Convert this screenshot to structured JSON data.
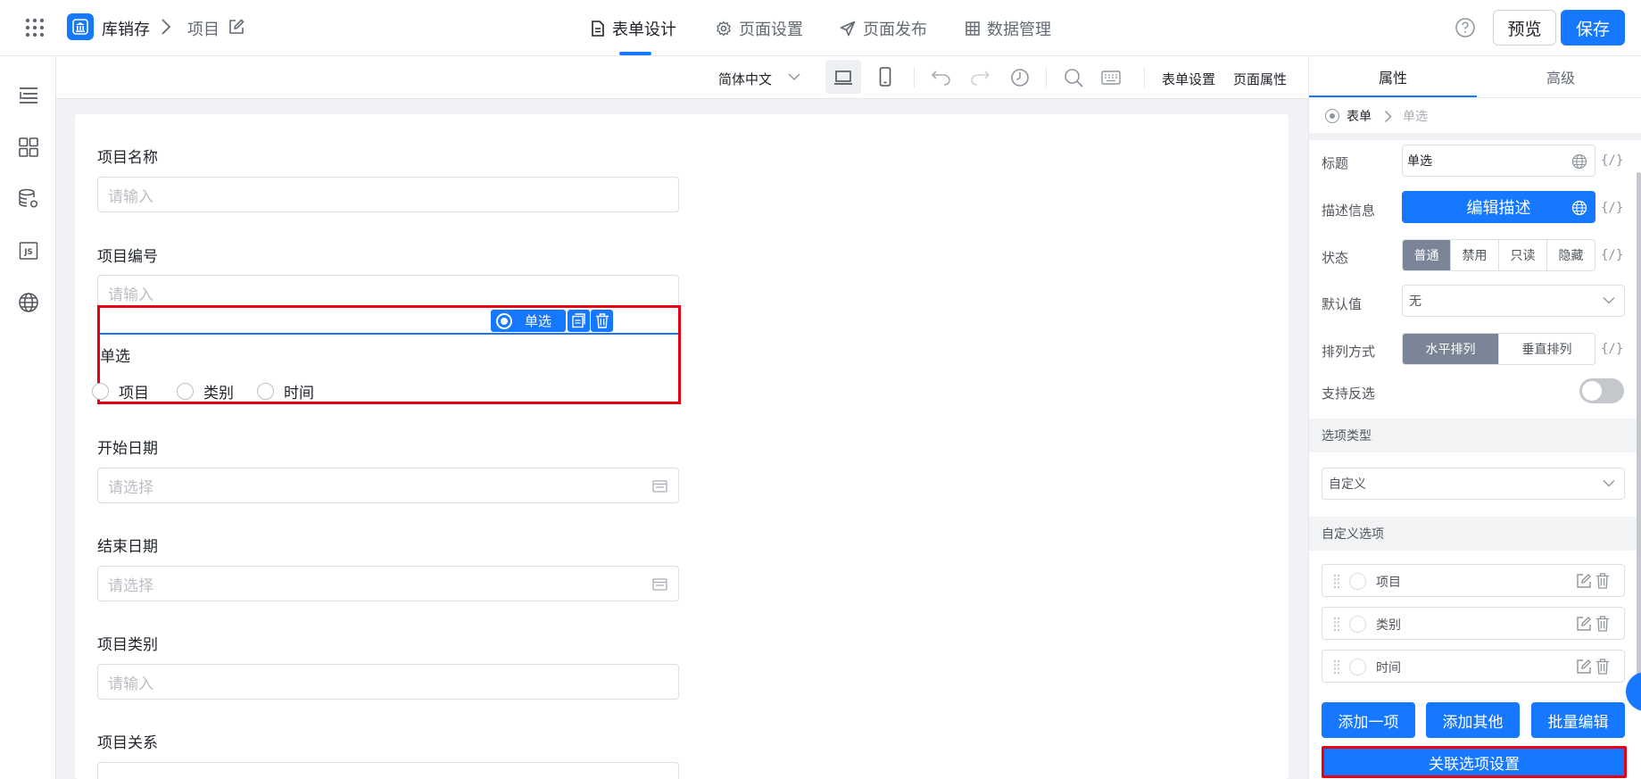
{
  "header": {
    "app_name": "库销存",
    "page_name": "项目",
    "tabs": [
      {
        "label": "表单设计",
        "icon": "document-icon"
      },
      {
        "label": "页面设置",
        "icon": "gear-icon"
      },
      {
        "label": "页面发布",
        "icon": "send-icon"
      },
      {
        "label": "数据管理",
        "icon": "grid-icon"
      }
    ],
    "preview_label": "预览",
    "save_label": "保存",
    "accent": "#1677ff"
  },
  "toolbar": {
    "language": "简体中文",
    "form_settings": "表单设置",
    "page_props": "页面属性"
  },
  "form": {
    "fields": [
      {
        "label": "项目名称",
        "placeholder": "请输入"
      },
      {
        "label": "项目编号",
        "placeholder": "请输入"
      },
      {
        "label": "开始日期",
        "placeholder": "请选择"
      },
      {
        "label": "结束日期",
        "placeholder": "请选择"
      },
      {
        "label": "项目类别",
        "placeholder": "请输入"
      },
      {
        "label": "项目关系",
        "placeholder": ""
      }
    ],
    "selected": {
      "chip_label": "单选",
      "title": "单选",
      "options": [
        "项目",
        "类别",
        "时间"
      ]
    }
  },
  "panel": {
    "tabs": [
      "属性",
      "高级"
    ],
    "crumb": [
      "表单",
      "单选"
    ],
    "title_label": "标题",
    "title_value": "单选",
    "desc_label": "描述信息",
    "desc_button": "编辑描述",
    "state_label": "状态",
    "states": [
      "普通",
      "禁用",
      "只读",
      "隐藏"
    ],
    "default_label": "默认值",
    "default_value": "无",
    "layout_label": "排列方式",
    "layouts": [
      "水平排列",
      "垂直排列"
    ],
    "deselect_label": "支持反选",
    "code_tag": "{/}",
    "option_type_heading": "选项类型",
    "option_type_value": "自定义",
    "custom_options_heading": "自定义选项",
    "options": [
      "项目",
      "类别",
      "时间"
    ],
    "add_one": "添加一项",
    "add_other": "添加其他",
    "batch_edit": "批量编辑",
    "linked_settings": "关联选项设置"
  }
}
